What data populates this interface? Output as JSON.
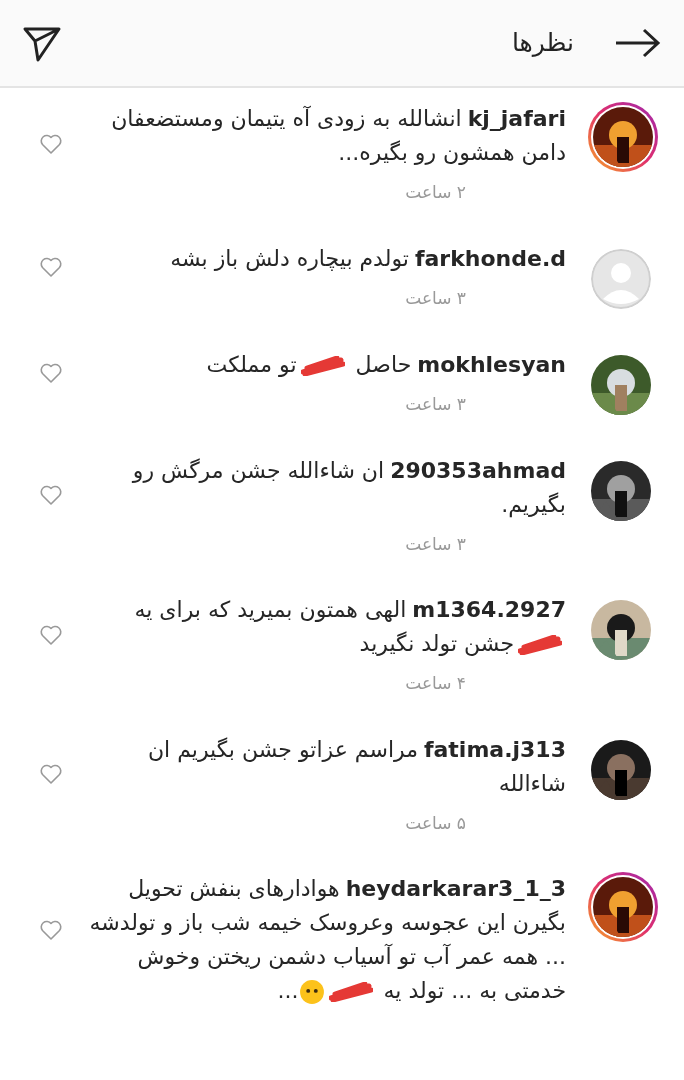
{
  "header": {
    "title": "نظرها"
  },
  "comments": [
    {
      "username": "kj_jafari",
      "avatar": {
        "kind": "picture",
        "ring": true
      },
      "segments": [
        {
          "kind": "text",
          "text": "انشالله به زودی آه یتیمان ومستضعفان دامن همشون رو بگیره..."
        }
      ],
      "time": "۲ ساعت",
      "liked": false
    },
    {
      "username": "farkhonde.d",
      "avatar": {
        "kind": "default",
        "ring": false
      },
      "segments": [
        {
          "kind": "text",
          "text": "تولدم بیچاره دلش باز بشه"
        }
      ],
      "time": "۳ ساعت",
      "liked": false
    },
    {
      "username": "mokhlesyan",
      "avatar": {
        "kind": "picture",
        "ring": false
      },
      "segments": [
        {
          "kind": "text",
          "text": "حاصل"
        },
        {
          "kind": "redaction"
        },
        {
          "kind": "text",
          "text": "تو مملکت"
        }
      ],
      "time": "۳ ساعت",
      "liked": false
    },
    {
      "username": "290353ahmad",
      "avatar": {
        "kind": "picture",
        "ring": false
      },
      "segments": [
        {
          "kind": "text",
          "text": "ان شاءالله جشن مرگش رو بگیریم."
        }
      ],
      "time": "۳ ساعت",
      "liked": false
    },
    {
      "username": "m1364.2927",
      "avatar": {
        "kind": "picture",
        "ring": false
      },
      "segments": [
        {
          "kind": "text",
          "text": "الهی همتون بمیرید که برای یه"
        },
        {
          "kind": "redaction"
        },
        {
          "kind": "text",
          "text": "جشن تولد نگیرید"
        }
      ],
      "time": "۴ ساعت",
      "liked": false
    },
    {
      "username": "fatima.j313",
      "avatar": {
        "kind": "picture",
        "ring": false
      },
      "segments": [
        {
          "kind": "text",
          "text": "مراسم عزاتو جشن بگیریم ان شاءالله"
        }
      ],
      "time": "۵ ساعت",
      "liked": false
    },
    {
      "username": "heydarkarar3_1_3",
      "avatar": {
        "kind": "picture",
        "ring": true
      },
      "segments": [
        {
          "kind": "text",
          "text": "هوادارهای بنفش تحویل بگیرن این عجوسه وعروسک خیمه شب باز و تولدشه ... همه عمر آب تو آسیاب دشمن ریختن وخوش خدمتی به ... تولد یه"
        },
        {
          "kind": "redaction"
        },
        {
          "kind": "emoji"
        },
        {
          "kind": "text",
          "text": "..."
        }
      ],
      "liked": false
    }
  ]
}
